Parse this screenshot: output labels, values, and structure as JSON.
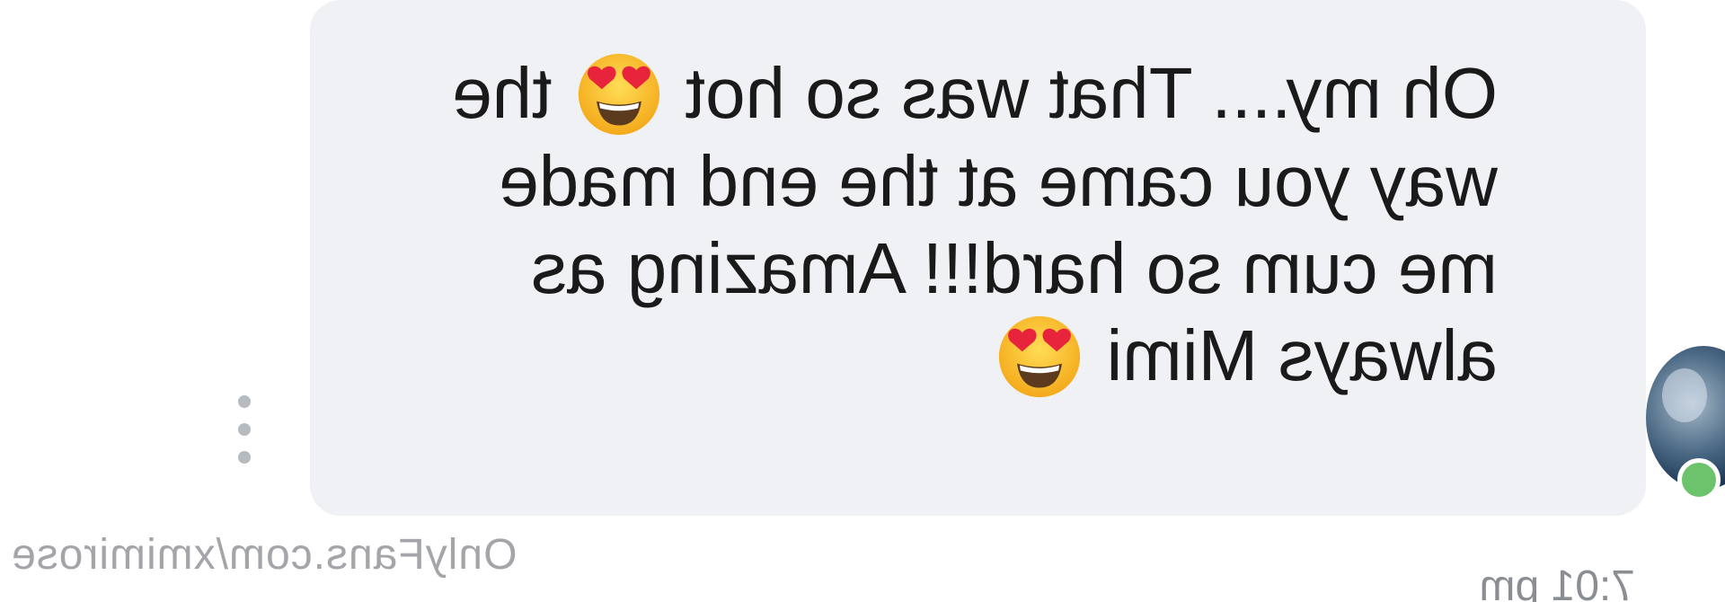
{
  "message": {
    "lines": [
      {
        "before": "Oh my.... That was so hot",
        "emoji": "heart-eyes-emoji",
        "after": "the"
      },
      {
        "before": "way you came at the end made",
        "emoji": null,
        "after": ""
      },
      {
        "before": "me cum so hard!!! Amazing as",
        "emoji": null,
        "after": ""
      },
      {
        "before": "always Mimi",
        "emoji": "heart-eyes-emoji",
        "after": ""
      }
    ],
    "timestamp": "7:01 pm"
  },
  "watermark": "OnlyFans.com/xmimirose",
  "status": {
    "online": true,
    "online_color": "#6cc36b"
  },
  "colors": {
    "bubble_bg": "#f0f1f4",
    "text": "#1a1a1a",
    "muted": "#8a8d92"
  },
  "icons": {
    "more": "more-vertical-icon",
    "emoji": "heart-eyes-emoji"
  }
}
